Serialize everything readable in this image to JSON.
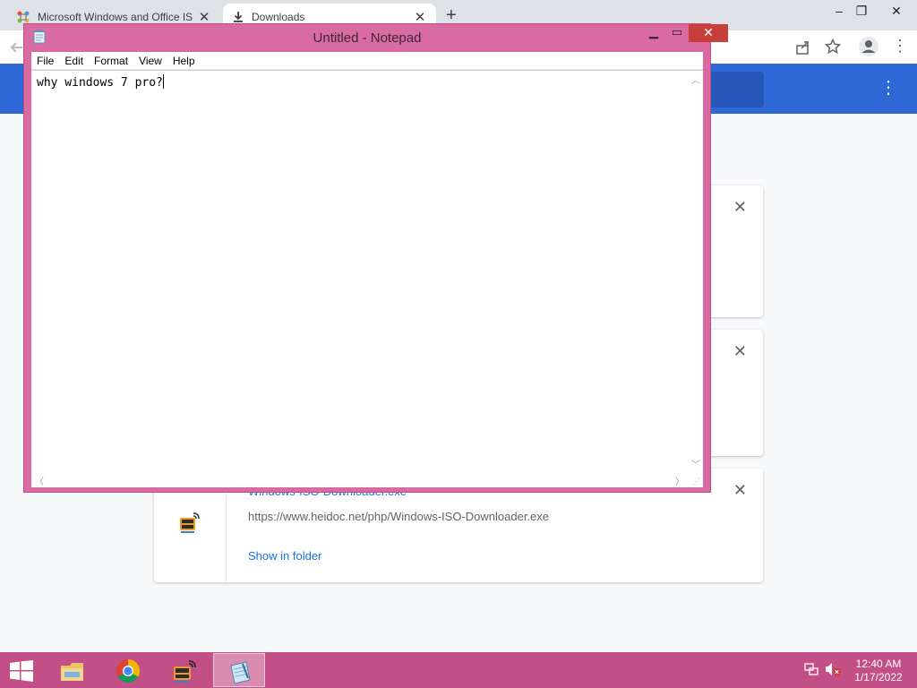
{
  "browser": {
    "tabs": [
      {
        "title": "Microsoft Windows and Office IS",
        "icon": "joomla-icon"
      },
      {
        "title": "Downloads",
        "icon": "download-icon"
      }
    ],
    "new_tab_label": "+",
    "window_controls": {
      "minimize": "–",
      "restore": "❐",
      "close": "✕"
    },
    "header_menu_icon": "⋮"
  },
  "downloads": {
    "cards": [
      {
        "close": "✕"
      },
      {
        "close": "✕"
      },
      {
        "name": "Windows-ISO-Downloader.exe",
        "url": "https://www.heidoc.net/php/Windows-ISO-Downloader.exe",
        "action": "Show in folder",
        "close": "✕",
        "icon": "heidoc-icon"
      }
    ]
  },
  "notepad": {
    "title": "Untitled - Notepad",
    "menu": [
      "File",
      "Edit",
      "Format",
      "View",
      "Help"
    ],
    "content": "why windows 7 pro?",
    "controls": {
      "minimize": "▁",
      "maximize": "▭",
      "close": "✕"
    }
  },
  "taskbar": {
    "apps": [
      "start-icon",
      "file-explorer-icon",
      "chrome-icon",
      "heidoc-icon",
      "notepad-icon"
    ],
    "time": "12:40 AM",
    "date": "1/17/2022"
  },
  "colors": {
    "chrome_header": "#2e67d6",
    "notepad_frame": "#d96aa2",
    "taskbar": "#c24f86",
    "link": "#1a73e8"
  }
}
